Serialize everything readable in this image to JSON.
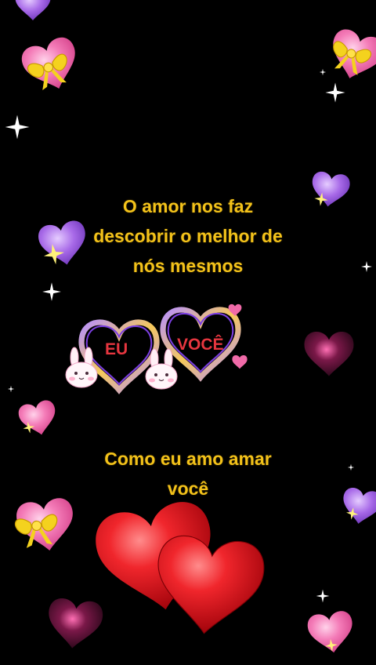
{
  "quote_top": {
    "lines": [
      "O amor nos faz",
      "descobrir o melhor de",
      "nós mesmos"
    ]
  },
  "frame_labels": {
    "left": "EU",
    "right": "VOCÊ"
  },
  "quote_bottom": {
    "lines": [
      "Como eu amo amar",
      "você"
    ]
  },
  "colors": {
    "background": "#000000",
    "text": "#f3c21a",
    "frame_label": "#e6363f",
    "heart_pink": "#f06aa8",
    "heart_purple": "#a56ce8",
    "heart_red": "#e1141c",
    "ribbon": "#f4d21e"
  },
  "icons": [
    "heart-gift-icon",
    "heart-icon",
    "sparkle-icon",
    "bunny-icon",
    "heart-frame-icon"
  ]
}
